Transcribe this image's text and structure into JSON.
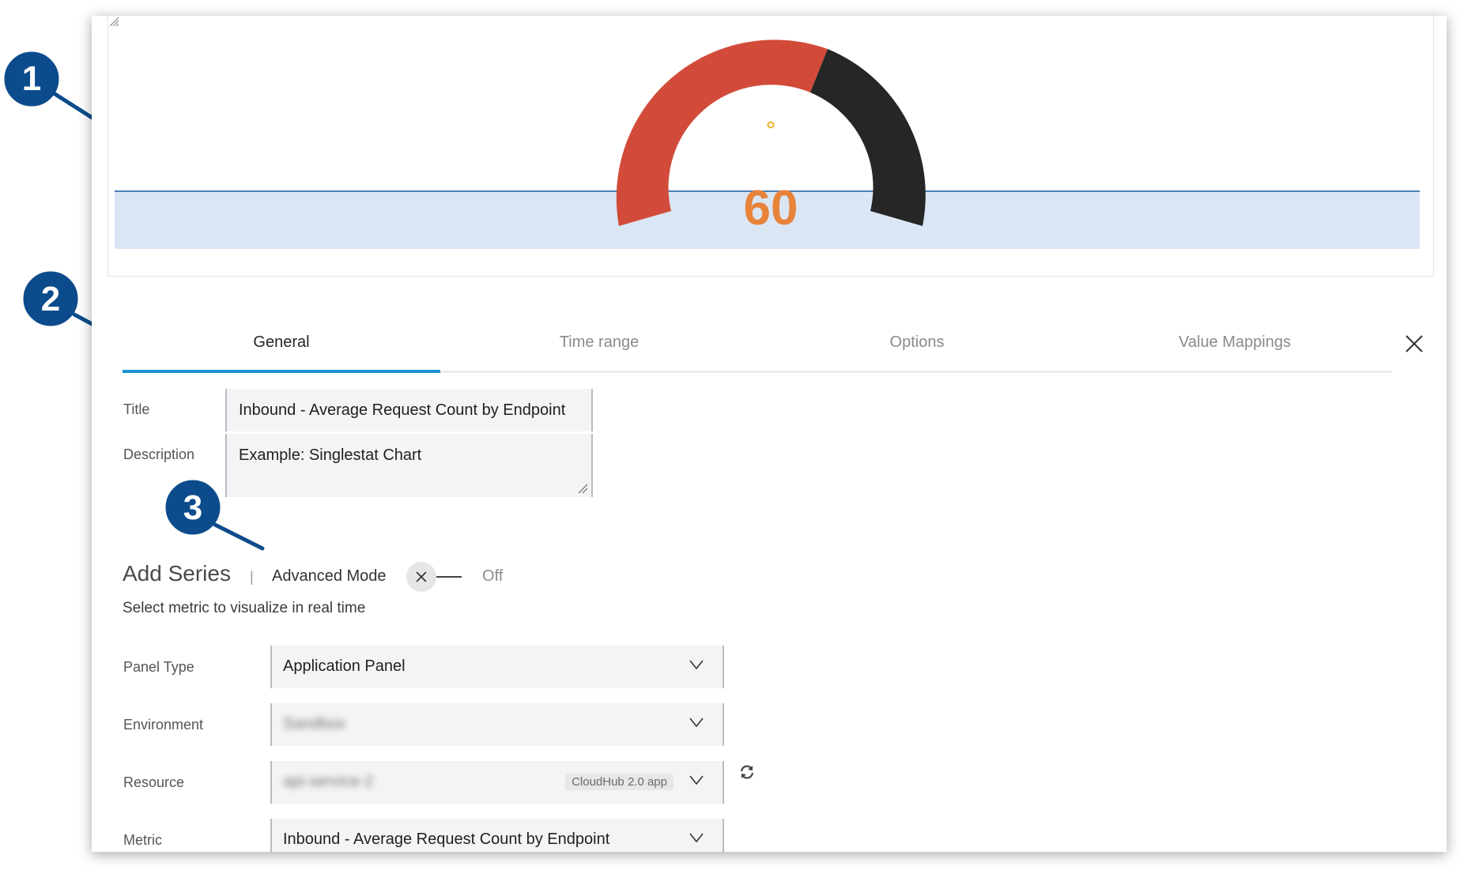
{
  "preview": {
    "gauge_value": "60",
    "value_color": "#e8833a",
    "gauge_colors": {
      "red": "#d24b3a",
      "dark": "#262626",
      "band": "#dbe6f4",
      "line": "#4a7fb5"
    }
  },
  "tabs": [
    {
      "label": "General",
      "active": true
    },
    {
      "label": "Time range",
      "active": false
    },
    {
      "label": "Options",
      "active": false
    },
    {
      "label": "Value Mappings",
      "active": false
    }
  ],
  "general": {
    "title_label": "Title",
    "title_value": "Inbound - Average Request Count by Endpoint",
    "description_label": "Description",
    "description_value": "Example: Singlestat Chart"
  },
  "add_series": {
    "heading": "Add Series",
    "separator": "|",
    "advanced_mode_label": "Advanced Mode",
    "advanced_mode_state": "Off",
    "helper_text": "Select metric to visualize in real time"
  },
  "series_fields": {
    "panel_type_label": "Panel Type",
    "panel_type_value": "Application Panel",
    "environment_label": "Environment",
    "environment_value": "Sandbox",
    "resource_label": "Resource",
    "resource_value": "api-service-2",
    "resource_badge": "CloudHub 2.0 app",
    "metric_label": "Metric",
    "metric_value": "Inbound - Average Request Count by Endpoint"
  },
  "callouts": [
    "1",
    "2",
    "3"
  ],
  "accent_color": "#1c92d8",
  "callout_color": "#0d4c8c"
}
